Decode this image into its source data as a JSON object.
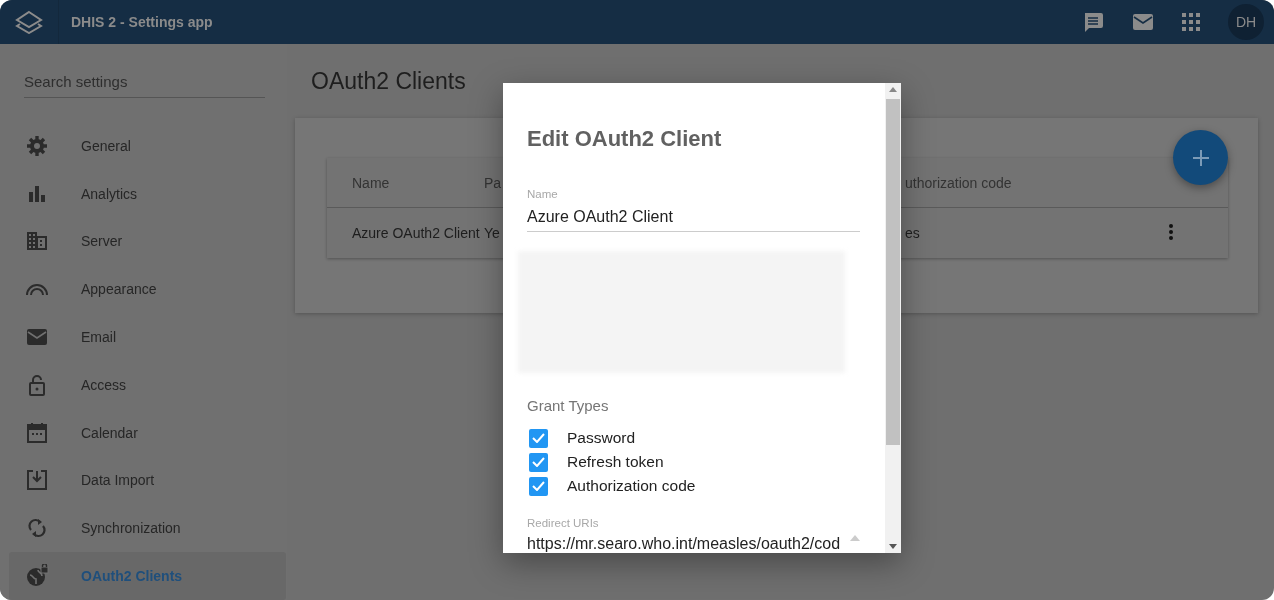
{
  "header": {
    "title": "DHIS 2 - Settings app",
    "avatar": "DH"
  },
  "sidebar": {
    "search": {
      "placeholder": "Search settings"
    },
    "items": [
      {
        "label": "General",
        "selected": false
      },
      {
        "label": "Analytics",
        "selected": false
      },
      {
        "label": "Server",
        "selected": false
      },
      {
        "label": "Appearance",
        "selected": false
      },
      {
        "label": "Email",
        "selected": false
      },
      {
        "label": "Access",
        "selected": false
      },
      {
        "label": "Calendar",
        "selected": false
      },
      {
        "label": "Data Import",
        "selected": false
      },
      {
        "label": "Synchronization",
        "selected": false
      },
      {
        "label": "OAuth2 Clients",
        "selected": true
      }
    ]
  },
  "page": {
    "title": "OAuth2 Clients",
    "table": {
      "columns": [
        "Name",
        "Pa",
        "uthorization code"
      ],
      "rows": [
        {
          "cells": [
            "Azure OAuth2 Client",
            "Ye",
            "es"
          ]
        }
      ]
    }
  },
  "dialog": {
    "title": "Edit OAuth2 Client",
    "name_field": {
      "label": "Name",
      "value": "Azure OAuth2 Client"
    },
    "grant_types": {
      "label": "Grant Types",
      "options": [
        {
          "label": "Password",
          "checked": true
        },
        {
          "label": "Refresh token",
          "checked": true
        },
        {
          "label": "Authorization code",
          "checked": true
        }
      ]
    },
    "redirect_uris": {
      "label": "Redirect URIs",
      "value": "https://mr.searo.who.int/measles/oauth2/cod"
    }
  }
}
